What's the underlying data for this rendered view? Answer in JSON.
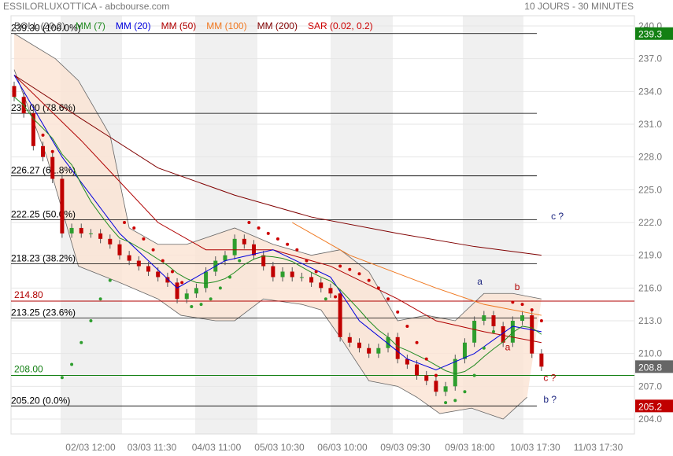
{
  "header": {
    "title": "ESSILORLUXOTTICA - abcbourse.com",
    "period": "10 JOURS - 30 MINUTES"
  },
  "legend": [
    {
      "label": "BOLL (20,2)",
      "color": "#555555"
    },
    {
      "label": "MM (7)",
      "color": "#228B22"
    },
    {
      "label": "MM (20)",
      "color": "#0000dd"
    },
    {
      "label": "MM (50)",
      "color": "#b00000"
    },
    {
      "label": "MM (100)",
      "color": "#f07820"
    },
    {
      "label": "MM (200)",
      "color": "#800000"
    },
    {
      "label": "SAR (0.02, 0.2)",
      "color": "#cc0000"
    }
  ],
  "chart_data": {
    "type": "candlestick",
    "ylim": [
      203,
      241
    ],
    "yticks": [
      "240.0",
      "237.0",
      "234.0",
      "231.0",
      "228.0",
      "225.0",
      "222.0",
      "219.0",
      "216.0",
      "213.0",
      "210.0",
      "207.0",
      "204.0"
    ],
    "xticks": [
      "02/03 12:00",
      "03/03 11:30",
      "04/03 11:00",
      "05/03 10:30",
      "06/03 10:00",
      "09/03 09:30",
      "09/03 18:00",
      "10/03 17:30",
      "11/03 17:30"
    ],
    "badges": [
      {
        "label": "239.3",
        "value": 239.3,
        "color": "#138013"
      },
      {
        "label": "208.8",
        "value": 208.8,
        "color": "#666666"
      },
      {
        "label": "205.2",
        "value": 205.2,
        "color": "#c00000"
      }
    ],
    "fibonacci": [
      {
        "label": "239.30  (100.0%)",
        "value": 239.3
      },
      {
        "label": "232.00  (78.6%)",
        "value": 232.0
      },
      {
        "label": "226.27  (61.8%)",
        "value": 226.27
      },
      {
        "label": "222.25  (50.0%)",
        "value": 222.25
      },
      {
        "label": "218.23  (38.2%)",
        "value": 218.23
      },
      {
        "label": "213.25  (23.6%)",
        "value": 213.25
      },
      {
        "label": "205.20  (0.0%)",
        "value": 205.2
      }
    ],
    "levels": [
      {
        "label": "214.80",
        "value": 214.8,
        "color": "#b00000"
      },
      {
        "label": "208.00",
        "value": 208.0,
        "color": "#138013"
      }
    ],
    "closes": [
      233.5,
      232,
      229,
      228,
      226,
      221,
      221.5,
      221,
      221,
      220.5,
      220,
      219,
      218.5,
      218,
      217.5,
      217,
      216.5,
      215,
      215.5,
      216,
      217.5,
      218.5,
      219,
      220.5,
      220,
      219,
      218,
      217,
      217.5,
      217,
      217,
      216.5,
      216,
      215.5,
      211.5,
      211,
      210.5,
      210,
      210.5,
      211.5,
      209.5,
      209,
      208,
      207.5,
      206.5,
      207,
      209.5,
      211,
      213,
      213.5,
      212.5,
      211,
      213,
      213.5,
      210,
      208.8
    ],
    "first_open": 234.5,
    "mm200": [
      [
        0,
        235.5
      ],
      [
        7,
        231.5
      ],
      [
        15,
        227
      ],
      [
        23,
        224.5
      ],
      [
        31,
        222.5
      ],
      [
        40,
        221
      ],
      [
        48,
        219.8
      ],
      [
        55,
        219
      ]
    ],
    "mm100": [
      [
        29,
        222
      ],
      [
        35,
        219
      ],
      [
        44,
        216
      ],
      [
        49,
        214.5
      ],
      [
        55,
        213.5
      ]
    ],
    "mm50": [
      [
        0,
        235.5
      ],
      [
        7,
        229.5
      ],
      [
        15,
        222
      ],
      [
        20,
        219.5
      ],
      [
        27,
        219.5
      ],
      [
        33,
        218
      ],
      [
        40,
        215
      ],
      [
        44,
        213
      ],
      [
        49,
        212
      ],
      [
        55,
        211
      ]
    ],
    "mm20": [
      [
        0,
        235.5
      ],
      [
        5,
        228
      ],
      [
        11,
        221
      ],
      [
        17,
        216
      ],
      [
        22,
        218.5
      ],
      [
        27,
        219.5
      ],
      [
        33,
        217
      ],
      [
        36,
        213
      ],
      [
        41,
        209.5
      ],
      [
        44,
        208.5
      ],
      [
        48,
        210
      ],
      [
        52,
        212.5
      ],
      [
        55,
        212
      ]
    ],
    "boll_upper": [
      [
        0,
        239.3
      ],
      [
        4.3,
        237
      ],
      [
        6.7,
        235
      ],
      [
        10,
        230
      ],
      [
        12,
        221.5
      ],
      [
        15,
        220
      ],
      [
        18,
        220
      ],
      [
        23,
        221.5
      ],
      [
        27,
        220
      ],
      [
        31,
        219
      ],
      [
        34,
        219.5
      ],
      [
        37,
        217.5
      ],
      [
        40,
        213
      ],
      [
        43,
        213.5
      ],
      [
        46,
        213
      ],
      [
        49,
        215.5
      ],
      [
        52,
        215.5
      ],
      [
        55,
        215
      ]
    ],
    "boll_lower": [
      [
        0,
        236
      ],
      [
        3.4,
        228
      ],
      [
        6.7,
        218
      ],
      [
        11,
        216.5
      ],
      [
        15,
        215
      ],
      [
        17.4,
        213.5
      ],
      [
        21,
        213
      ],
      [
        23,
        213
      ],
      [
        26,
        215
      ],
      [
        30,
        214.5
      ],
      [
        32,
        214
      ],
      [
        34,
        211.5
      ],
      [
        37,
        207.5
      ],
      [
        40,
        207
      ],
      [
        42,
        206
      ],
      [
        44.4,
        204.5
      ],
      [
        47.7,
        205
      ],
      [
        51,
        204
      ],
      [
        53.5,
        206
      ]
    ],
    "sar": [
      [
        2,
        231
      ],
      [
        3,
        230
      ],
      [
        4,
        228.5
      ],
      [
        5,
        207.8
      ],
      [
        6,
        209
      ],
      [
        7,
        211
      ],
      [
        8,
        213
      ],
      [
        9,
        215
      ],
      [
        10,
        216.7
      ],
      [
        11.5,
        222
      ],
      [
        12.5,
        221.5
      ],
      [
        13.5,
        220.5
      ],
      [
        14.5,
        219.5
      ],
      [
        15.5,
        218.5
      ],
      [
        16.5,
        217.5
      ],
      [
        17.5,
        216.5
      ],
      [
        18.5,
        214.3
      ],
      [
        19.5,
        214.5
      ],
      [
        20.5,
        215
      ],
      [
        21.5,
        216
      ],
      [
        22.5,
        217
      ],
      [
        23.5,
        218.5
      ],
      [
        24.5,
        222
      ],
      [
        25.5,
        221.5
      ],
      [
        26.5,
        221
      ],
      [
        27.5,
        220.5
      ],
      [
        28.5,
        220
      ],
      [
        29.5,
        219.5
      ],
      [
        30.5,
        218.5
      ],
      [
        31.5,
        217.5
      ],
      [
        32.5,
        215
      ],
      [
        33.5,
        215.2
      ],
      [
        34,
        218
      ],
      [
        35,
        217.7
      ],
      [
        36,
        217.3
      ],
      [
        37,
        216.7
      ],
      [
        38,
        216
      ],
      [
        39,
        215
      ],
      [
        40,
        213.8
      ],
      [
        41,
        212.5
      ],
      [
        42,
        211
      ],
      [
        43,
        209.5
      ],
      [
        44,
        208
      ],
      [
        45,
        205.5
      ],
      [
        46,
        205.7
      ],
      [
        47,
        206.5
      ],
      [
        48,
        208
      ],
      [
        49,
        210.5
      ],
      [
        50,
        212
      ],
      [
        52,
        214.7
      ],
      [
        53,
        214.5
      ],
      [
        54,
        214
      ],
      [
        55,
        213
      ]
    ],
    "annotations": [
      {
        "label": "a",
        "color": "#1a237e",
        "idx": 48.3,
        "value": 216.3
      },
      {
        "label": "b",
        "color": "#b00000",
        "idx": 52.2,
        "value": 215.8
      },
      {
        "label": "a",
        "color": "#b00000",
        "idx": 51.2,
        "value": 210.3
      },
      {
        "label": "c ?",
        "color": "#1a237e",
        "idx": 56,
        "value": 222.3
      },
      {
        "label": "c ?",
        "color": "#b00000",
        "idx": 55.2,
        "value": 207.5
      },
      {
        "label": "b ?",
        "color": "#1a237e",
        "idx": 55.2,
        "value": 205.5
      }
    ]
  }
}
